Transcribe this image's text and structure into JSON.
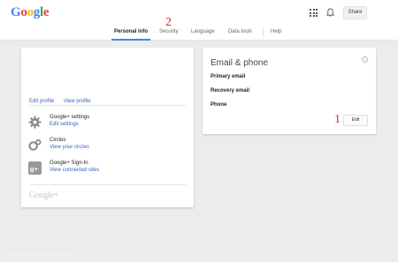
{
  "header": {
    "logo": "Google",
    "share_label": "Share"
  },
  "tabs": [
    "Personal info",
    "Security",
    "Language",
    "Data tools",
    "Help"
  ],
  "annotations": {
    "security_marker": "2",
    "edit_marker": "1"
  },
  "profile": {
    "edit_profile": "Edit profile",
    "view_profile": "View profile",
    "items": [
      {
        "title": "Google+ settings",
        "link": "Edit settings",
        "icon": "gear-icon"
      },
      {
        "title": "Circles",
        "link": "View your circles",
        "icon": "circles-icon"
      },
      {
        "title": "Google+ Sign-In",
        "link": "View connected sites",
        "icon": "gplus-icon"
      }
    ],
    "footer_logo": "Google+"
  },
  "email_phone": {
    "title": "Email & phone",
    "fields": [
      "Primary email",
      "Recovery email",
      "Phone"
    ],
    "edit_label": "Edit"
  },
  "watermark": "Copyright © Google Inc. All rights"
}
